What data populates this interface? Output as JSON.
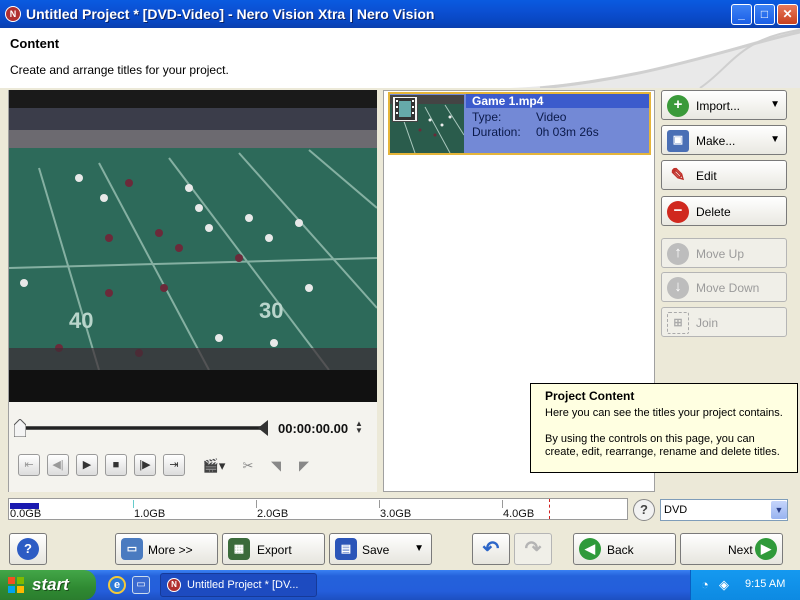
{
  "window": {
    "title": "Untitled Project * [DVD-Video] - Nero Vision Xtra | Nero Vision",
    "minimize": "_",
    "maximize": "□",
    "close": "✕"
  },
  "header": {
    "title": "Content",
    "subtitle": "Create and arrange titles for your project."
  },
  "player": {
    "timecode": "00:00:00.00"
  },
  "titles": [
    {
      "name": "Game 1.mp4",
      "type_label": "Type:",
      "type_value": "Video",
      "duration_label": "Duration:",
      "duration_value": "0h 03m 26s"
    }
  ],
  "actions": {
    "import": "Import...",
    "make": "Make...",
    "edit": "Edit",
    "delete": "Delete",
    "move_up": "Move Up",
    "move_down": "Move Down",
    "join": "Join"
  },
  "tooltip": {
    "title": "Project Content",
    "line1": "Here you can see the titles your project contains.",
    "line2": "By using the controls on this page, you can create, edit, rearrange, rename and delete titles."
  },
  "capacity": {
    "labels": [
      "0.0GB",
      "1.0GB",
      "2.0GB",
      "3.0GB",
      "4.0GB"
    ],
    "used_fraction": 0.047,
    "disc_type": "DVD"
  },
  "bottom": {
    "help": "?",
    "more": "More >>",
    "export": "Export",
    "save": "Save",
    "back": "Back",
    "next": "Next"
  },
  "taskbar": {
    "start": "start",
    "task_item": "Untitled Project * [DV...",
    "clock": "9:15 AM"
  },
  "colors": {
    "title_bar": "#0b4fd2",
    "selected_item": "#7389d6",
    "selection_border": "#e5b53a",
    "tooltip_bg": "#ffffe1",
    "start_green": "#2f8a32"
  }
}
